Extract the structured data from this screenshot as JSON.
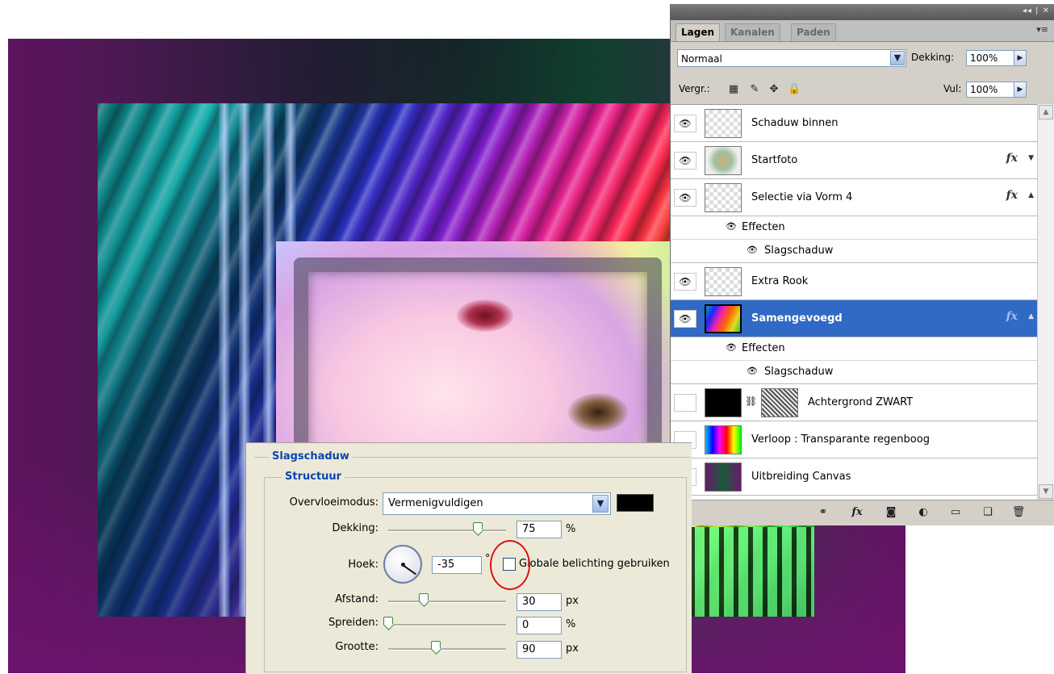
{
  "layers_panel": {
    "tabs": [
      "Lagen",
      "Kanalen",
      "Paden"
    ],
    "titlebar_controls": "◂◂ | ✕",
    "blend_mode": "Normaal",
    "opacity_label": "Dekking:",
    "opacity_value": "100%",
    "lock_label": "Vergr.:",
    "fill_label": "Vul:",
    "fill_value": "100%",
    "layers": [
      {
        "name": "Schaduw binnen",
        "visible": true,
        "fx": false
      },
      {
        "name": "Startfoto",
        "visible": true,
        "fx": true
      },
      {
        "name": "Selectie via Vorm 4",
        "visible": true,
        "fx": true
      },
      {
        "name": "Extra Rook",
        "visible": true,
        "fx": false
      },
      {
        "name": "Samengevoegd",
        "visible": true,
        "fx": true,
        "selected": true
      },
      {
        "name": "Achtergrond ZWART",
        "visible": false,
        "fx": false
      },
      {
        "name": "Verloop : Transparante regenboog",
        "visible": false,
        "fx": false
      },
      {
        "name": "Uitbreiding Canvas",
        "visible": false,
        "fx": false
      }
    ],
    "effects_label": "Effecten",
    "effect_name": "Slagschaduw",
    "footer_icons": [
      "link-icon",
      "fx-icon",
      "mask-icon",
      "adjustment-icon",
      "folder-icon",
      "new-layer-icon",
      "trash-icon"
    ]
  },
  "dialog": {
    "title": "Slagschaduw",
    "section": "Structuur",
    "blend_label": "Overvloeimodus:",
    "blend_value": "Vermenigvuldigen",
    "shadow_color": "#000000",
    "opacity_label": "Dekking:",
    "opacity_value": "75",
    "opacity_unit": "%",
    "angle_label": "Hoek:",
    "angle_value": "-35",
    "angle_unit": "°",
    "global_light_label": "Globale belichting gebruiken",
    "global_light_checked": false,
    "distance_label": "Afstand:",
    "distance_value": "30",
    "distance_unit": "px",
    "spread_label": "Spreiden:",
    "spread_value": "0",
    "spread_unit": "%",
    "size_label": "Grootte:",
    "size_value": "90",
    "size_unit": "px"
  },
  "colors": {
    "selection": "#316ac5",
    "dialog_heading": "#0a46b0",
    "highlight_circle": "#e01010"
  }
}
